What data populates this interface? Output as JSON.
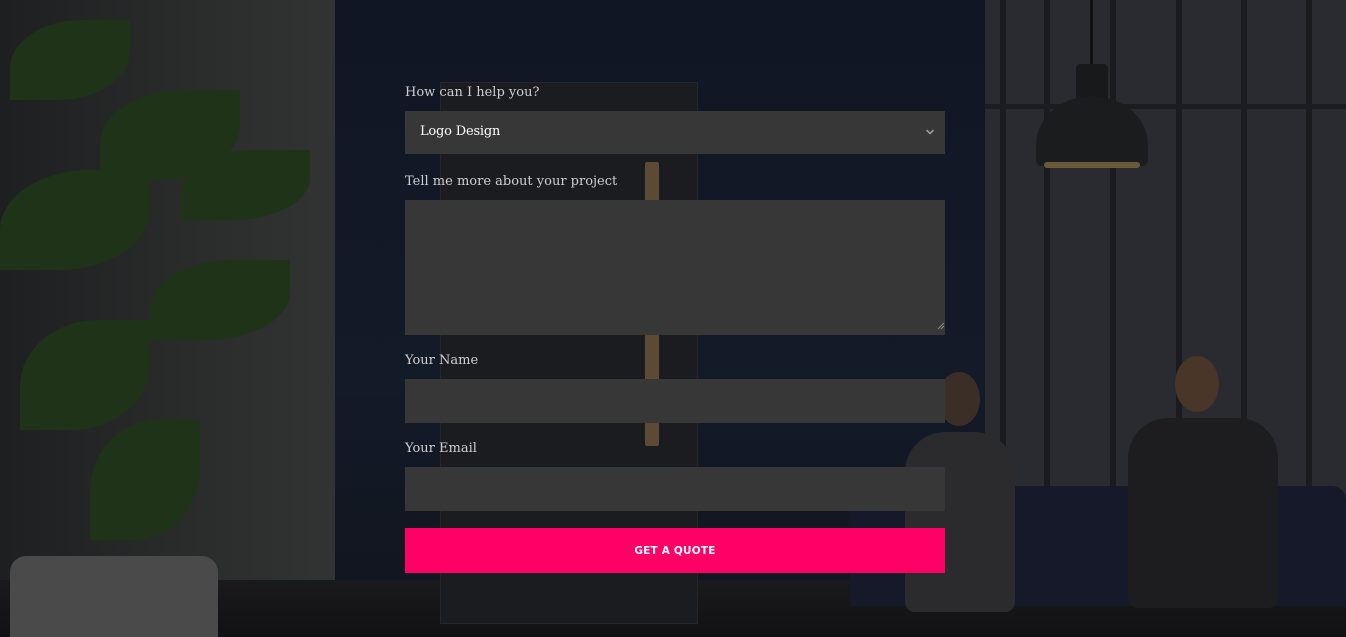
{
  "form": {
    "service_label": "How can I help you?",
    "service_value": "Logo Design",
    "project_label": "Tell me more about your project",
    "project_value": "",
    "name_label": "Your Name",
    "name_value": "",
    "email_label": "Your Email",
    "email_value": "",
    "submit_label": "GET A QUOTE"
  },
  "colors": {
    "accent": "#ff0066",
    "field_background": "#373737",
    "overlay_background": "#17181c"
  },
  "icons": {
    "select": "chevron-down-icon",
    "textarea": "resize-handle-icon"
  }
}
